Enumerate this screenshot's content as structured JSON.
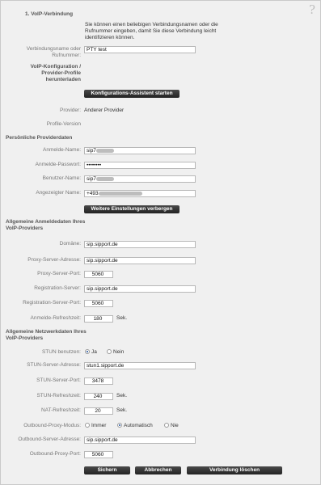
{
  "section_title": "1. VoIP-Verbindung",
  "intro_text": "Sie können einen beliebigen Verbindungsnamen oder die Rufnummer eingeben, damit Sie diese Verbindung leicht identifizieren können.",
  "connection": {
    "label": "Verbindungsname oder Rufnummer:",
    "value": "PTY test"
  },
  "voip_config": {
    "label": "VoIP-Konfiguration / Provider-Profile herunterladen",
    "assistant_button": "Konfigurations-Assistent starten",
    "provider_label": "Provider:",
    "provider_value": "Anderer Provider",
    "profile_version_label": "Profile-Version"
  },
  "personal": {
    "heading": "Persönliche Providerdaten",
    "login_name_label": "Anmelde-Name:",
    "login_name_value": "sip7",
    "password_label": "Anmelde-Passwort:",
    "password_value": "••••••••",
    "user_name_label": "Benutzer-Name:",
    "user_name_value": "sip7",
    "display_name_label": "Angezeigter Name:",
    "display_name_value": "+493",
    "toggle_button": "Weitere Einstellungen verbergen"
  },
  "general_login": {
    "heading": "Allgemeine Anmeldedaten Ihres VoIP-Providers",
    "domain_label": "Domäne:",
    "domain_value": "sip.sipport.de",
    "proxy_address_label": "Proxy-Server-Adresse:",
    "proxy_address_value": "sip.sipport.de",
    "proxy_port_label": "Proxy-Server-Port:",
    "proxy_port_value": "5060",
    "registration_server_label": "Registration-Server:",
    "registration_server_value": "sip.sipport.de",
    "registration_port_label": "Registration-Server-Port:",
    "registration_port_value": "5060",
    "refresh_label": "Anmelde-Refreshzeit:",
    "refresh_value": "180",
    "refresh_unit": "Sek."
  },
  "network": {
    "heading": "Allgemeine Netzwerkdaten Ihres VoIP-Providers",
    "stun_use_label": "STUN benutzen:",
    "stun_yes": "Ja",
    "stun_no": "Nein",
    "stun_address_label": "STUN-Server-Adresse:",
    "stun_address_value": "stun1.sipport.de",
    "stun_port_label": "STUN-Server-Port:",
    "stun_port_value": "3478",
    "stun_refresh_label": "STUN-Refreshzeit:",
    "stun_refresh_value": "240",
    "stun_refresh_unit": "Sek.",
    "nat_refresh_label": "NAT-Refreshzeit:",
    "nat_refresh_value": "20",
    "nat_refresh_unit": "Sek.",
    "outbound_mode_label": "Outbound-Proxy-Modus:",
    "mode_always": "Immer",
    "mode_auto": "Automatisch",
    "mode_never": "Nie",
    "outbound_address_label": "Outbound-Server-Adresse:",
    "outbound_address_value": "sip.sipport.de",
    "outbound_port_label": "Outbound-Proxy-Port:",
    "outbound_port_value": "5060"
  },
  "actions": {
    "save": "Sichern",
    "cancel": "Abbrechen",
    "delete": "Verbindung löschen"
  },
  "help_symbol": "?"
}
